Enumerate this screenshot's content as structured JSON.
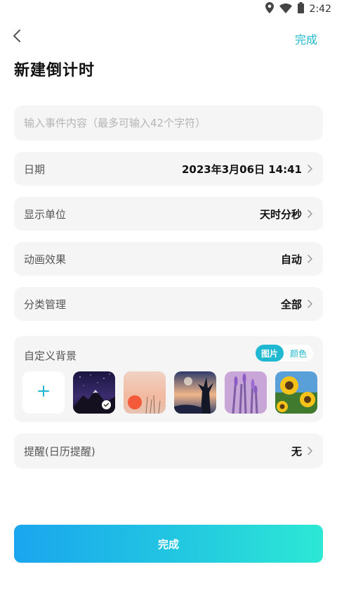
{
  "status_bar": {
    "time": "2:42",
    "icons": [
      "location-icon",
      "wifi-icon",
      "battery-icon"
    ]
  },
  "header": {
    "done_label": "完成",
    "title": "新建倒计时"
  },
  "event_input": {
    "placeholder": "输入事件内容（最多可输入42个字符）",
    "value": ""
  },
  "rows": {
    "date": {
      "label": "日期",
      "value": "2023年3月06日 14:41"
    },
    "unit": {
      "label": "显示单位",
      "value": "天时分秒"
    },
    "animation": {
      "label": "动画效果",
      "value": "自动"
    },
    "category": {
      "label": "分类管理",
      "value": "全部"
    },
    "reminder": {
      "label": "提醒(日历提醒)",
      "value": "无"
    }
  },
  "background": {
    "label": "自定义背景",
    "tabs": [
      {
        "label": "图片",
        "active": true
      },
      {
        "label": "颜色",
        "active": false
      }
    ],
    "add_icon": "plus-icon",
    "thumbnails": [
      {
        "name": "night-mountain",
        "selected": true
      },
      {
        "name": "sunset",
        "selected": false
      },
      {
        "name": "tree-silhouette",
        "selected": false
      },
      {
        "name": "lavender",
        "selected": false
      },
      {
        "name": "sunflowers",
        "selected": false
      }
    ]
  },
  "submit": {
    "label": "完成"
  },
  "colors": {
    "accent": "#1fb8d0",
    "card_bg": "#f5f5f5",
    "gradient_start": "#1aa5ee",
    "gradient_end": "#2de8d4"
  }
}
